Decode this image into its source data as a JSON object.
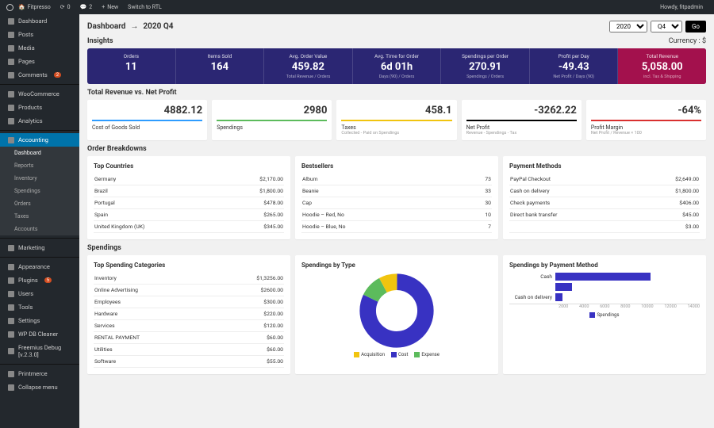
{
  "topbar": {
    "site": "Fitpresso",
    "updates": "0",
    "comments": "2",
    "new": "New",
    "rtl": "Switch to RTL",
    "howdy": "Howdy, fitpadmin"
  },
  "sidebar": {
    "items": [
      {
        "label": "Dashboard",
        "icon": "speedometer-icon"
      },
      {
        "label": "Posts",
        "icon": "pin-icon"
      },
      {
        "label": "Media",
        "icon": "media-icon"
      },
      {
        "label": "Pages",
        "icon": "page-icon"
      },
      {
        "label": "Comments",
        "icon": "comment-icon",
        "badge": "2"
      },
      {
        "label": "WooCommerce",
        "icon": "woo-icon"
      },
      {
        "label": "Products",
        "icon": "box-icon"
      },
      {
        "label": "Analytics",
        "icon": "chart-icon"
      },
      {
        "label": "Accounting",
        "icon": "calc-icon",
        "active": true,
        "subs": [
          "Dashboard",
          "Reports",
          "Inventory",
          "Spendings",
          "Orders",
          "Taxes",
          "Accounts"
        ]
      },
      {
        "label": "Marketing",
        "icon": "megaphone-icon"
      },
      {
        "label": "Appearance",
        "icon": "brush-icon"
      },
      {
        "label": "Plugins",
        "icon": "plug-icon",
        "badge": "5"
      },
      {
        "label": "Users",
        "icon": "user-icon"
      },
      {
        "label": "Tools",
        "icon": "wrench-icon"
      },
      {
        "label": "Settings",
        "icon": "gear-icon"
      },
      {
        "label": "WP DB Cleaner",
        "icon": "db-icon"
      },
      {
        "label": "Freemius Debug [v.2.3.0]",
        "icon": "bug-icon"
      },
      {
        "label": "Printmerce",
        "icon": "cart-icon"
      },
      {
        "label": "Collapse menu",
        "icon": "collapse-icon"
      }
    ]
  },
  "crumb": {
    "a": "Dashboard",
    "b": "2020 Q4",
    "year": "2020",
    "quarter": "Q4",
    "go": "Go"
  },
  "insights_title": "Insights",
  "insights_currency": "Currency : $",
  "insights": [
    {
      "label": "Orders",
      "value": "11",
      "sub": ""
    },
    {
      "label": "Items Sold",
      "value": "164",
      "sub": ""
    },
    {
      "label": "Avg. Order Value",
      "value": "459.82",
      "sub": "Total Revenue / Orders"
    },
    {
      "label": "Avg. Time for Order",
      "value": "6d 01h",
      "sub": "Days (90) / Orders"
    },
    {
      "label": "Spendings per Order",
      "value": "270.91",
      "sub": "Spendings / Orders"
    },
    {
      "label": "Profit per Day",
      "value": "-49.43",
      "sub": "Net Profit / Days (90)"
    },
    {
      "label": "Total Revenue",
      "value": "5,058.00",
      "sub": "incl. Tax & Shipping"
    }
  ],
  "rev_title": "Total Revenue vs. Net Profit",
  "kpis": [
    {
      "v": "4882.12",
      "bar": "#2e9cff",
      "l": "Cost of Goods Sold",
      "d": ""
    },
    {
      "v": "2980",
      "bar": "#5cbb5c",
      "l": "Spendings",
      "d": ""
    },
    {
      "v": "458.1",
      "bar": "#f1c40f",
      "l": "Taxes",
      "d": "Collected - Paid on Spendings"
    },
    {
      "v": "-3262.22",
      "bar": "#000",
      "l": "Net Profit",
      "d": "Revenue - Spendings - Tax"
    },
    {
      "v": "-64%",
      "bar": "#d9302f",
      "l": "Profit Margin",
      "d": "Net Profit / Revenue × 100"
    }
  ],
  "order_bd": "Order Breakdowns",
  "top_countries": {
    "title": "Top Countries",
    "rows": [
      [
        "Germany",
        "$2,170.00"
      ],
      [
        "Brazil",
        "$1,800.00"
      ],
      [
        "Portugal",
        "$478.00"
      ],
      [
        "Spain",
        "$265.00"
      ],
      [
        "United Kingdom (UK)",
        "$345.00"
      ]
    ]
  },
  "bestsellers": {
    "title": "Bestsellers",
    "rows": [
      [
        "Album",
        "73"
      ],
      [
        "Beanie",
        "33"
      ],
      [
        "Cap",
        "30"
      ],
      [
        "Hoodie – Red, No",
        "10"
      ],
      [
        "Hoodie – Blue, No",
        "7"
      ]
    ]
  },
  "payment": {
    "title": "Payment Methods",
    "rows": [
      [
        "PayPal Checkout",
        "$2,649.00"
      ],
      [
        "Cash on delivery",
        "$1,800.00"
      ],
      [
        "Check payments",
        "$406.00"
      ],
      [
        "Direct bank transfer",
        "$45.00"
      ],
      [
        "",
        "$3.00"
      ]
    ]
  },
  "spend_title": "Spendings",
  "spend_cats": {
    "title": "Top Spending Categories",
    "rows": [
      [
        "Inventory",
        "$1,3256.00"
      ],
      [
        "Online Advertising",
        "$2600.00"
      ],
      [
        "Employees",
        "$300.00"
      ],
      [
        "Hardware",
        "$220.00"
      ],
      [
        "Services",
        "$120.00"
      ],
      [
        "RENTAL PAYMENT",
        "$60.00"
      ],
      [
        "Utilities",
        "$60.00"
      ],
      [
        "Software",
        "$55.00"
      ]
    ]
  },
  "chart_data": [
    {
      "type": "pie",
      "title": "Spendings by Type",
      "series": [
        {
          "name": "Acquisition",
          "value": 8,
          "color": "#f1c40f"
        },
        {
          "name": "Cost",
          "value": 82,
          "color": "#3832c2"
        },
        {
          "name": "Expense",
          "value": 10,
          "color": "#5cbb5c"
        }
      ],
      "legend": [
        "Acquisition",
        "Cost",
        "Expense"
      ]
    },
    {
      "type": "bar",
      "title": "Spendings by Payment Method",
      "orientation": "horizontal",
      "categories": [
        "Cash",
        "",
        "Cash on delivery"
      ],
      "values": [
        10500,
        1800,
        800
      ],
      "xlim": [
        0,
        14000
      ],
      "xticks": [
        2000,
        4000,
        6000,
        8000,
        10000,
        12000,
        14000
      ],
      "legend": [
        "Spendings"
      ],
      "color": "#3832c2"
    }
  ]
}
